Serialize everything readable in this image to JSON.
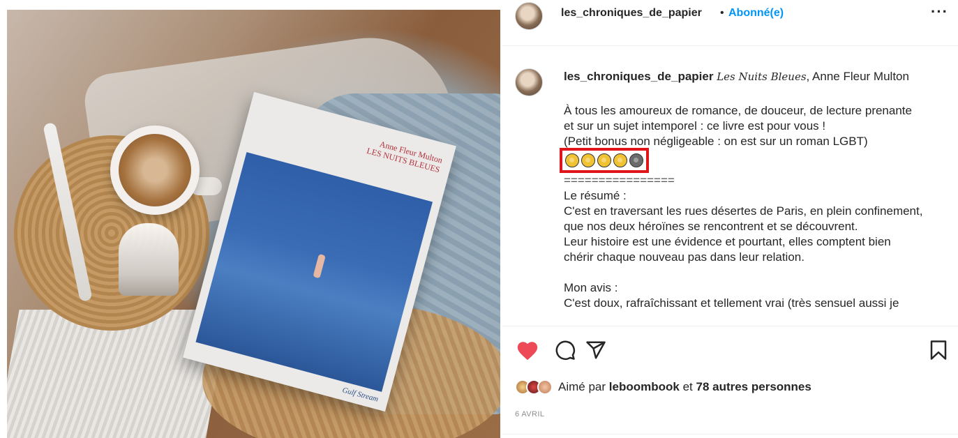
{
  "header": {
    "username": "les_chroniques_de_papier",
    "separator": "•",
    "follow_status": "Abonné(e)",
    "more_label": "···"
  },
  "post_image": {
    "book_title_line1": "Anne Fleur Multon",
    "book_title_line2": "LES NUITS BLEUES",
    "publisher": "Gulf Stream"
  },
  "caption": {
    "username": "les_chroniques_de_papier",
    "title_script": "Les Nuits Bleues",
    "author": ", Anne Fleur Multon",
    "paragraph1": "À tous les amoureux de romance, de douceur, de lecture prenante\net sur un sujet intemporel : ce livre est pour vous !\n(Petit bonus non négligeable : on est sur un roman LGBT)",
    "rating_filled": 4,
    "rating_total": 5,
    "divider": "================",
    "summary": "Le résumé :\nC'est en traversant les rues désertes de Paris, en plein confinement,\nque nos deux héroïnes se rencontrent et se découvrent.\nLeur histoire est une évidence et pourtant, elles comptent bien\nchérir chaque nouveau pas dans leur relation.",
    "opinion": "Mon avis :\nC'est doux, rafraîchissant et tellement vrai (très sensuel aussi je"
  },
  "actions": {
    "liked": true,
    "like_color": "#ed4956"
  },
  "likes": {
    "prefix": "Aimé par",
    "user": "leboombook",
    "connector": "et",
    "others": "78 autres personnes"
  },
  "date": "6 AVRIL",
  "colors": {
    "accent_blue": "#0095f6",
    "highlight_red": "#e0141b"
  }
}
